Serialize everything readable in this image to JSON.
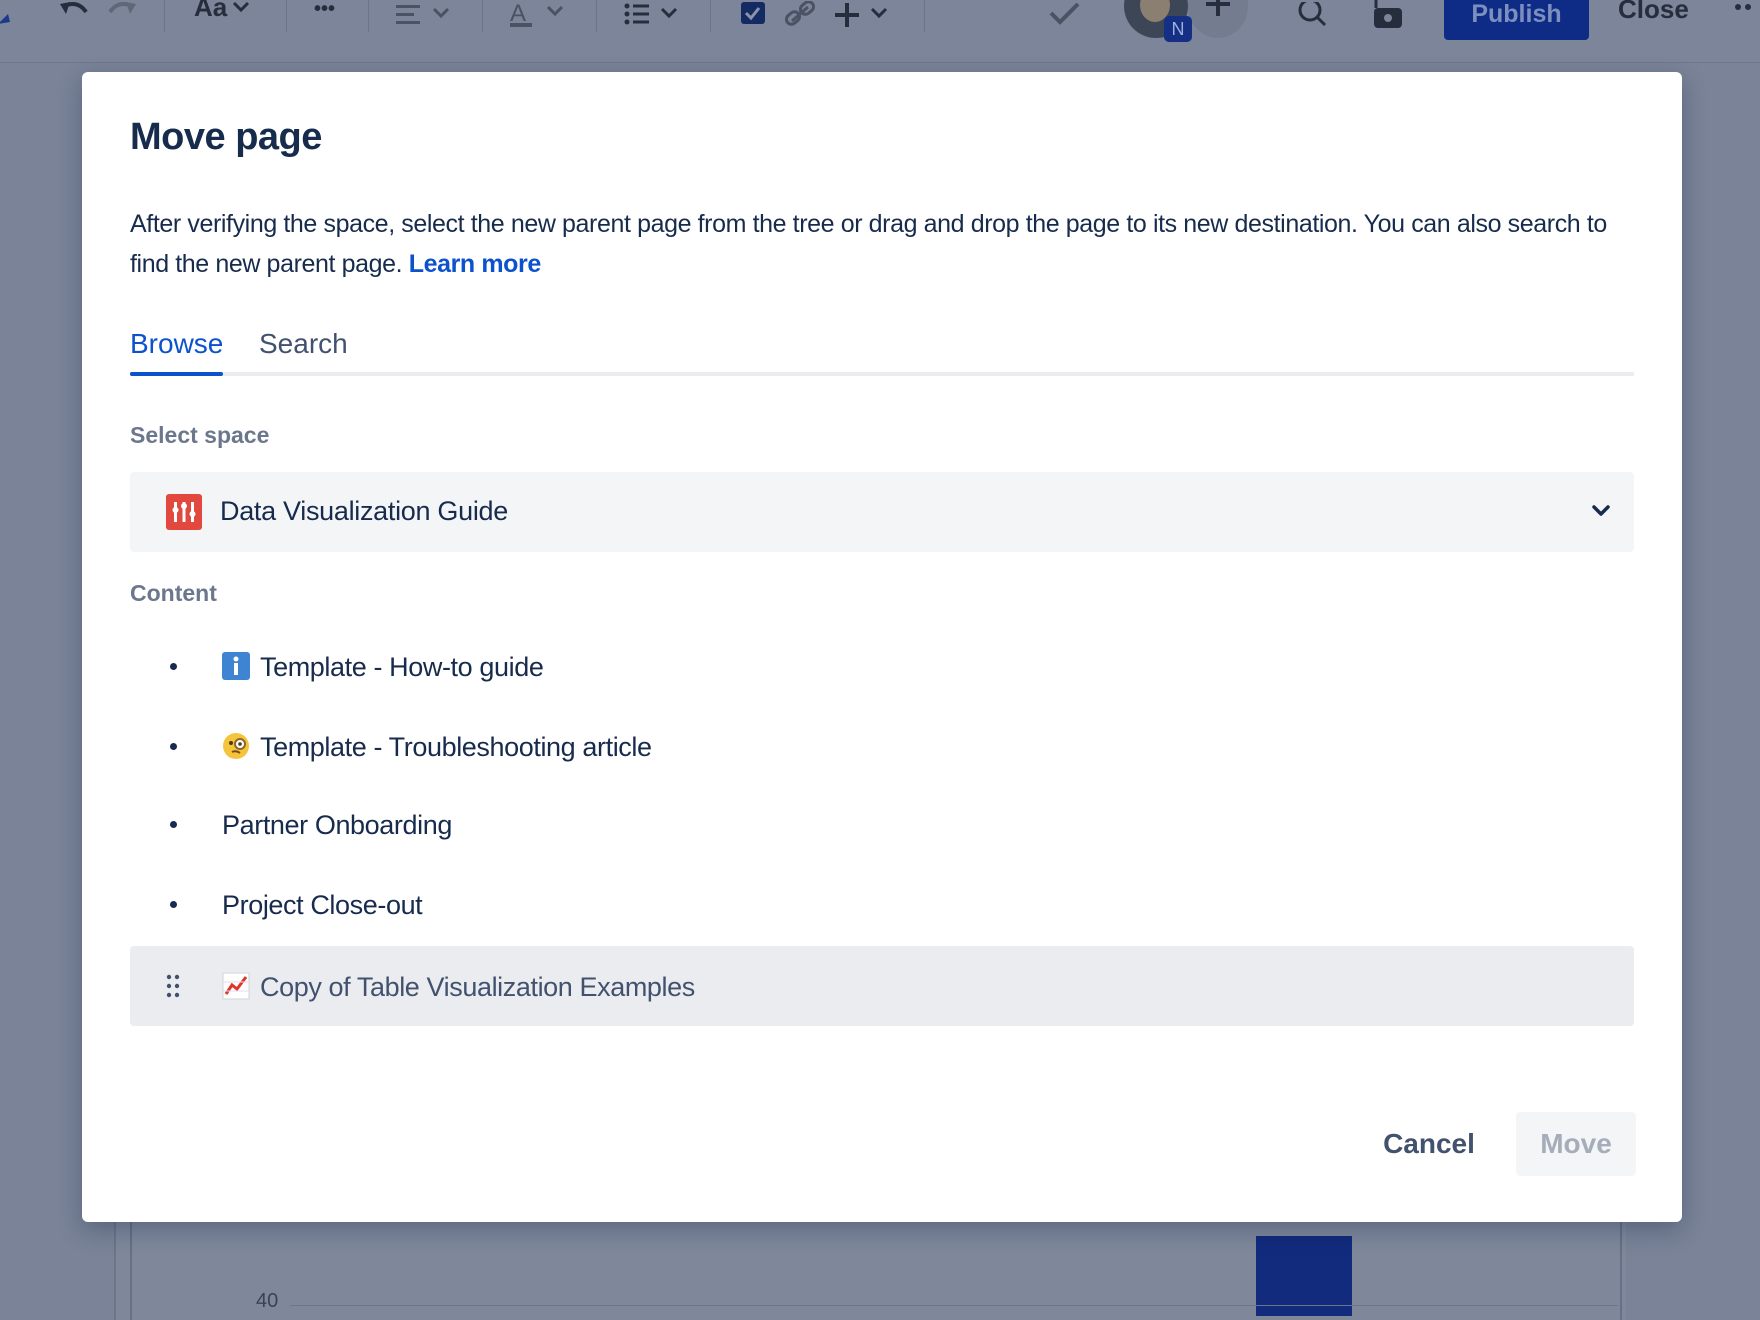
{
  "editor_toolbar": {
    "text_style_label": "Aa",
    "more_label": "•••",
    "publish_label": "Publish",
    "close_label": "Close",
    "avatar_badge": "N"
  },
  "background_chart": {
    "tick_label": "40"
  },
  "modal": {
    "title": "Move page",
    "description": "After verifying the space, select the new parent page from the tree or drag and drop the page to its new destination. You can also search to find the new parent page.",
    "learn_more": "Learn more",
    "tabs": [
      {
        "label": "Browse",
        "active": true
      },
      {
        "label": "Search",
        "active": false
      }
    ],
    "select_space_label": "Select space",
    "space": {
      "name": "Data Visualization Guide",
      "icon": "space-chart-icon"
    },
    "content_label": "Content",
    "tree_items": [
      {
        "label": "Template - How-to guide",
        "icon": "info-icon"
      },
      {
        "label": "Template - Troubleshooting article",
        "icon": "monocle-face-icon"
      },
      {
        "label": "Partner Onboarding",
        "icon": ""
      },
      {
        "label": "Project Close-out",
        "icon": ""
      },
      {
        "label": "Copy of Table Visualization Examples",
        "icon": "chart-increasing-icon",
        "selected": true
      }
    ],
    "cancel_label": "Cancel",
    "move_label": "Move"
  },
  "colors": {
    "accent": "#0c52cc",
    "overlay": "#7a8397",
    "publish": "#0e2c86"
  }
}
